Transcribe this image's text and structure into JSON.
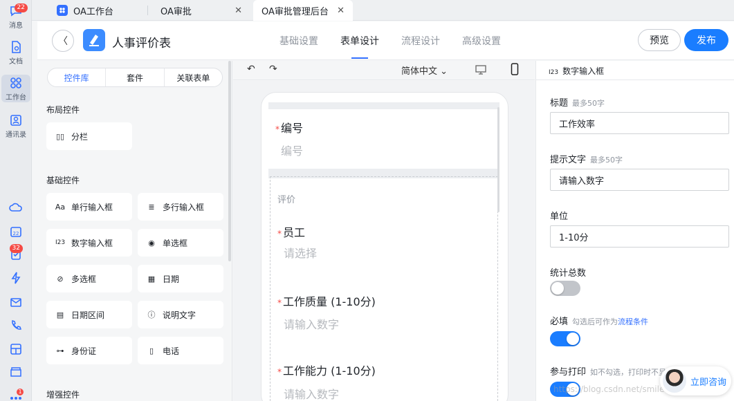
{
  "rail": {
    "messages_label": "消息",
    "messages_badge": "22",
    "docs_label": "文档",
    "workbench_label": "工作台",
    "contacts_label": "通讯录",
    "todo_badge": "32",
    "bottom_badge": "1"
  },
  "tabs": [
    {
      "label": "OA工作台"
    },
    {
      "label": "OA审批"
    },
    {
      "label": "OA审批管理后台"
    }
  ],
  "header": {
    "title": "人事评价表",
    "steps": [
      "基础设置",
      "表单设计",
      "流程设计",
      "高级设置"
    ],
    "active_step": "表单设计",
    "preview_label": "预览",
    "publish_label": "发布"
  },
  "library": {
    "tabs": [
      "控件库",
      "套件",
      "关联表单"
    ],
    "active_tab": "控件库",
    "layout_title": "布局控件",
    "layout_widgets": [
      "分栏"
    ],
    "basic_title": "基础控件",
    "basic_widgets": [
      "单行输入框",
      "多行输入框",
      "数字输入框",
      "单选框",
      "多选框",
      "日期",
      "日期区间",
      "说明文字",
      "身份证",
      "电话"
    ],
    "enhanced_title": "增强控件"
  },
  "toolbar": {
    "language": "简体中文"
  },
  "form": {
    "field_id_label": "编号",
    "field_id_placeholder": "编号",
    "group_title": "评价",
    "employee_label": "员工",
    "employee_placeholder": "请选择",
    "quality_label": "工作质量 (1-10分)",
    "quality_placeholder": "请输入数字",
    "ability_label": "工作能力 (1-10分)",
    "ability_placeholder": "请输入数字"
  },
  "props": {
    "header": "数字输入框",
    "header_icon": "I23",
    "title_label": "标题",
    "title_hint": "最多50字",
    "title_value": "工作效率",
    "placeholder_label": "提示文字",
    "placeholder_hint": "最多50字",
    "placeholder_value": "请输入数字",
    "unit_label": "单位",
    "unit_value": "1-10分",
    "sum_label": "统计总数",
    "sum_on": false,
    "required_label": "必填",
    "required_hint": "勾选后可作为",
    "required_link": "流程条件",
    "required_on": true,
    "print_label": "参与打印",
    "print_hint": "如不勾选，打印时不显示该项",
    "print_on": true
  },
  "consult": {
    "label": "立即咨询"
  },
  "watermark": "https://blog.csdn.net/smile2506",
  "colors": {
    "accent": "#1a7dff",
    "required": "#f54a45"
  }
}
